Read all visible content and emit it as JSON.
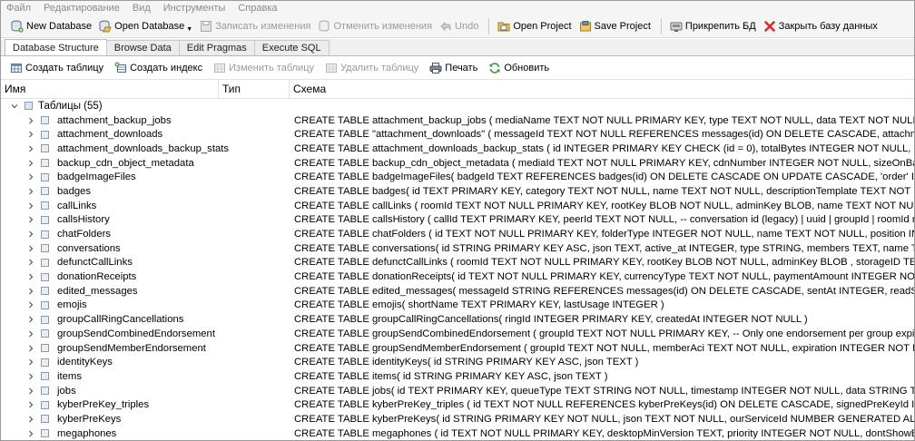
{
  "menu": [
    "Файл",
    "Редактирование",
    "Вид",
    "Инструменты",
    "Справка"
  ],
  "toolbar": {
    "new_db": "New Database",
    "open_db": "Open Database",
    "write_changes": "Записать изменения",
    "revert_changes": "Отменить изменения",
    "undo": "Undo",
    "open_project": "Open Project",
    "save_project": "Save Project",
    "attach_db": "Прикрепить БД",
    "close_db": "Закрыть базу данных"
  },
  "tabs": [
    "Database Structure",
    "Browse Data",
    "Edit Pragmas",
    "Execute SQL"
  ],
  "actions": {
    "create_table": "Создать таблицу",
    "create_index": "Создать индекс",
    "modify_table": "Изменить таблицу",
    "delete_table": "Удалить таблицу",
    "print": "Печать",
    "refresh": "Обновить"
  },
  "columns": {
    "name": "Имя",
    "type": "Тип",
    "schema": "Схема"
  },
  "group": {
    "label": "Таблицы (55)"
  },
  "rows": [
    {
      "name": "attachment_backup_jobs",
      "schema": "CREATE TABLE attachment_backup_jobs ( mediaName TEXT NOT NULL PRIMARY KEY, type TEXT NOT NULL, data TEXT NOT NULL, receivedAt INTEGER"
    },
    {
      "name": "attachment_downloads",
      "schema": "CREATE TABLE \"attachment_downloads\" ( messageId TEXT NOT NULL REFERENCES messages(id) ON DELETE CASCADE, attachmentType TEXT NOT NULL"
    },
    {
      "name": "attachment_downloads_backup_stats",
      "schema": "CREATE TABLE attachment_downloads_backup_stats ( id INTEGER PRIMARY KEY CHECK (id = 0), totalBytes INTEGER NOT NULL, completedBytes INTEGER"
    },
    {
      "name": "backup_cdn_object_metadata",
      "schema": "CREATE TABLE backup_cdn_object_metadata ( mediaId TEXT NOT NULL PRIMARY KEY, cdnNumber INTEGER NOT NULL, sizeOnBackupCdn INTEGER"
    },
    {
      "name": "badgeImageFiles",
      "schema": "CREATE TABLE badgeImageFiles( badgeId TEXT REFERENCES badges(id) ON DELETE CASCADE ON UPDATE CASCADE, 'order' INTEGER NOT NULL, url"
    },
    {
      "name": "badges",
      "schema": "CREATE TABLE badges( id TEXT PRIMARY KEY, category TEXT NOT NULL, name TEXT NOT NULL, descriptionTemplate TEXT NOT NULL )"
    },
    {
      "name": "callLinks",
      "schema": "CREATE TABLE callLinks ( roomId TEXT NOT NULL PRIMARY KEY, rootKey BLOB NOT NULL, adminKey BLOB, name TEXT NOT NULL, -- Enum which s"
    },
    {
      "name": "callsHistory",
      "schema": "CREATE TABLE callsHistory ( callId TEXT PRIMARY KEY, peerId TEXT NOT NULL, -- conversation id (legacy) | uuid | groupId | roomId ringerId TEXT DE"
    },
    {
      "name": "chatFolders",
      "schema": "CREATE TABLE chatFolders ( id TEXT NOT NULL PRIMARY KEY, folderType INTEGER NOT NULL, name TEXT NOT NULL, position INTEGER NOT NULL, sh"
    },
    {
      "name": "conversations",
      "schema": "CREATE TABLE conversations( id STRING PRIMARY KEY ASC, json TEXT, active_at INTEGER, type STRING, members TEXT, name TEXT, profileName TEX"
    },
    {
      "name": "defunctCallLinks",
      "schema": "CREATE TABLE defunctCallLinks ( roomId TEXT NOT NULL PRIMARY KEY, rootKey BLOB NOT NULL, adminKey BLOB , storageID TEXT, storageVersion IN"
    },
    {
      "name": "donationReceipts",
      "schema": "CREATE TABLE donationReceipts( id TEXT NOT NULL PRIMARY KEY, currencyType TEXT NOT NULL, paymentAmount INTEGER NOT NULL, timestamp INTE"
    },
    {
      "name": "edited_messages",
      "schema": "CREATE TABLE edited_messages( messageId STRING REFERENCES messages(id) ON DELETE CASCADE, sentAt INTEGER, readStatus INTEGER , conve"
    },
    {
      "name": "emojis",
      "schema": "CREATE TABLE emojis( shortName TEXT PRIMARY KEY, lastUsage INTEGER )"
    },
    {
      "name": "groupCallRingCancellations",
      "schema": "CREATE TABLE groupCallRingCancellations( ringId INTEGER PRIMARY KEY, createdAt INTEGER NOT NULL )"
    },
    {
      "name": "groupSendCombinedEndorsement",
      "schema": "CREATE TABLE groupSendCombinedEndorsement ( groupId TEXT NOT NULL PRIMARY KEY, -- Only one endorsement per group expiration INTEGER NO"
    },
    {
      "name": "groupSendMemberEndorsement",
      "schema": "CREATE TABLE groupSendMemberEndorsement ( groupId TEXT NOT NULL, memberAci TEXT NOT NULL, expiration INTEGER NOT NULL, -- Unix timestam"
    },
    {
      "name": "identityKeys",
      "schema": "CREATE TABLE identityKeys( id STRING PRIMARY KEY ASC, json TEXT )"
    },
    {
      "name": "items",
      "schema": "CREATE TABLE items( id STRING PRIMARY KEY ASC, json TEXT )"
    },
    {
      "name": "jobs",
      "schema": "CREATE TABLE jobs( id TEXT PRIMARY KEY, queueType TEXT STRING NOT NULL, timestamp INTEGER NOT NULL, data STRING TEXT )"
    },
    {
      "name": "kyberPreKey_triples",
      "schema": "CREATE TABLE kyberPreKey_triples ( id TEXT NOT NULL REFERENCES kyberPreKeys(id) ON DELETE CASCADE, signedPreKeyId INTEGER NOT NULL, ba"
    },
    {
      "name": "kyberPreKeys",
      "schema": "CREATE TABLE kyberPreKeys( id STRING PRIMARY KEY NOT NULL, json TEXT NOT NULL, ourServiceId NUMBER GENERATED ALWAYS AS (json_extrac"
    },
    {
      "name": "megaphones",
      "schema": "CREATE TABLE megaphones ( id TEXT NOT NULL PRIMARY KEY, desktopMinVersion TEXT, priority INTEGER NOT NULL, dontShowBeforeEpochMs INTE"
    }
  ]
}
